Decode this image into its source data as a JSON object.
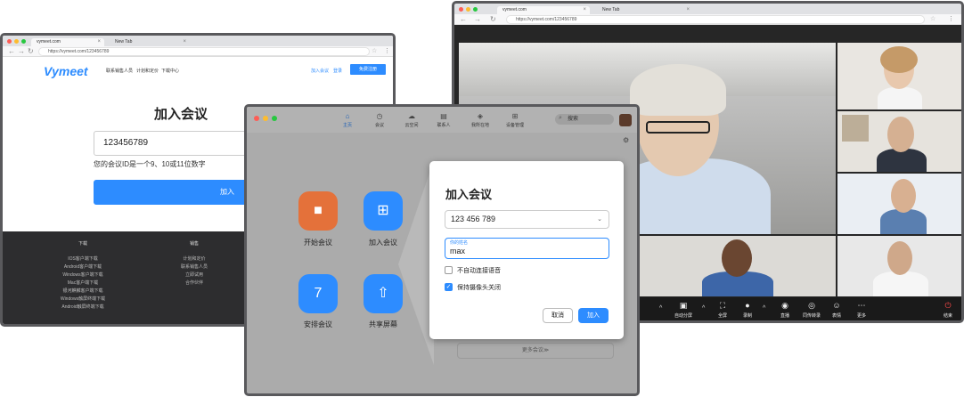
{
  "browser_left": {
    "tabs": [
      "vymeet.com",
      "New Tab"
    ],
    "url": "https://vymeet.com/123456789",
    "logo": "Vymeet",
    "nav": [
      "联系销售人员",
      "计划和定价",
      "下载中心"
    ],
    "nav_right": [
      "加入会议",
      "登录"
    ],
    "signup_label": "免费注册",
    "title": "加入会议",
    "meeting_id_value": "123456789",
    "hint": "您的会议ID是一个9、10或11位数字",
    "join_label": "加入",
    "footer": [
      {
        "heading": "下载",
        "items": [
          "IOS客户端下载",
          "Android客户端下载",
          "Windows客户端下载",
          "Mac客户端下载",
          "银河麒麟客户端下载",
          "Windows触屏终端下载",
          "Android触屏终端下载"
        ]
      },
      {
        "heading": "销售",
        "items": [
          "计划和定价",
          "联系销售人员",
          "立即试用",
          "合作伙伴"
        ]
      }
    ]
  },
  "app_window": {
    "nav": [
      {
        "icon": "home-icon",
        "label": "主页"
      },
      {
        "icon": "clock-icon",
        "label": "会议"
      },
      {
        "icon": "cloud-icon",
        "label": "云空间"
      },
      {
        "icon": "contacts-icon",
        "label": "联系人"
      },
      {
        "icon": "location-icon",
        "label": "我所在地"
      },
      {
        "icon": "grid-icon",
        "label": "设备管理"
      }
    ],
    "search_placeholder": "搜索",
    "actions": [
      {
        "icon": "video-camera-icon",
        "label": "开始会议",
        "color": "#e4713a"
      },
      {
        "icon": "plus-icon",
        "label": "加入会议",
        "color": "#2d8cff"
      },
      {
        "icon": "calendar-icon",
        "label": "安排会议",
        "color": "#2d8cff",
        "glyph": "7"
      },
      {
        "icon": "share-screen-icon",
        "label": "共享屏幕",
        "color": "#2d8cff"
      }
    ],
    "more_meetings": "更多会议≫"
  },
  "join_dialog": {
    "title": "加入会议",
    "meeting_id": "123 456 789",
    "name_label": "你的姓名",
    "name_value": "max",
    "options": [
      {
        "label": "不自动连接语音",
        "checked": false
      },
      {
        "label": "保持摄像头关闭",
        "checked": true
      }
    ],
    "cancel_label": "取消",
    "join_label": "加入"
  },
  "browser_right": {
    "tabs": [
      "vymeet.com",
      "New Tab"
    ],
    "url": "https://vymeet.com/123456789",
    "controls": [
      {
        "icon": "share-icon",
        "label": "自动分屏"
      },
      {
        "icon": "fullscreen-icon",
        "label": "全屏"
      },
      {
        "icon": "record-icon",
        "label": "录制"
      },
      {
        "icon": "live-icon",
        "label": "直播"
      },
      {
        "icon": "translate-icon",
        "label": "同传转录"
      },
      {
        "icon": "emoji-icon",
        "label": "表情"
      },
      {
        "icon": "more-icon",
        "label": "更多"
      },
      {
        "icon": "end-icon",
        "label": "结束"
      }
    ]
  }
}
